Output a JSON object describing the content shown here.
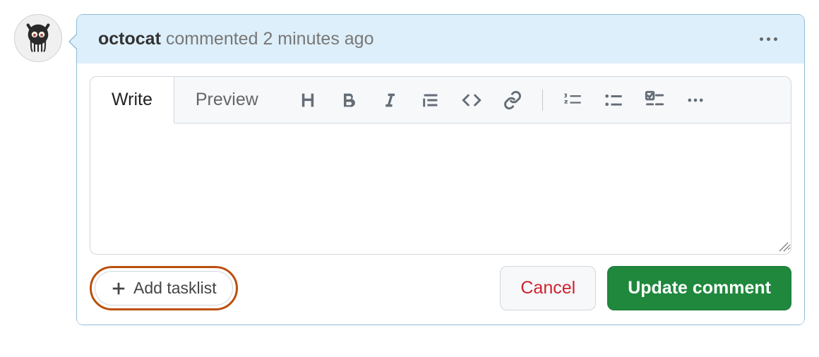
{
  "comment": {
    "author": "octocat",
    "action": "commented",
    "timestamp": "2 minutes ago",
    "body": ""
  },
  "tabs": {
    "write": "Write",
    "preview": "Preview"
  },
  "toolbar_icons": {
    "heading": "heading",
    "bold": "bold",
    "italic": "italic",
    "quote": "quote",
    "code": "code",
    "link": "link",
    "ordered_list": "numbered-list",
    "unordered_list": "bullet-list",
    "tasklist": "tasklist",
    "more": "more"
  },
  "actions": {
    "add_tasklist": "Add tasklist",
    "cancel": "Cancel",
    "submit": "Update comment"
  }
}
